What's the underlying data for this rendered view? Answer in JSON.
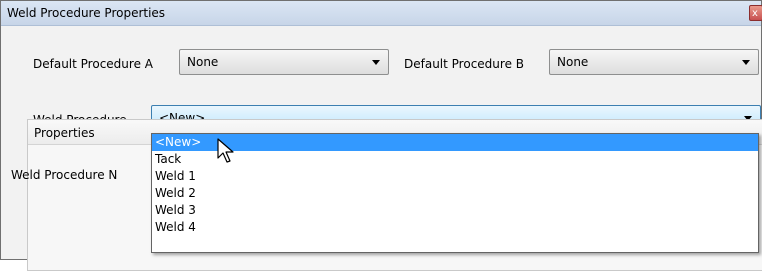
{
  "window": {
    "title": "Weld Procedure Properties",
    "close_label": "x"
  },
  "defaults": {
    "a_label": "Default Procedure A",
    "a_value": "None",
    "b_label": "Default Procedure B",
    "b_value": "None"
  },
  "weld_procedure": {
    "label": "Weld Procedure",
    "value": "<New>",
    "options": [
      "<New>",
      "Tack",
      "Weld 1",
      "Weld 2",
      "Weld 3",
      "Weld 4"
    ],
    "selected_index": 0
  },
  "properties": {
    "header": "Properties",
    "name_label": "Weld Procedure N"
  }
}
